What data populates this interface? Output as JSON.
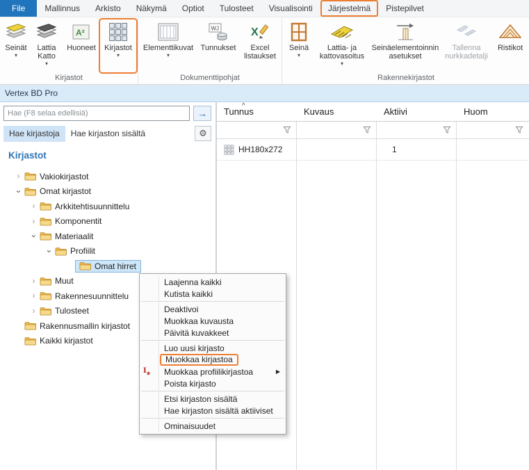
{
  "icons": {
    "chevron_down": "▾",
    "submenu_arrow": "▶",
    "gear": "⚙",
    "search_go_arrow": "→",
    "sort_ascending": "^",
    "huoneet_icon_text": "A²",
    "tunnukset_icon_text": "WJ",
    "excel_icon_text": "X"
  },
  "colors": {
    "file_tab_blue": "#2175bc",
    "annotation_orange": "#ed7d31",
    "selection_blue": "#cde6f8",
    "tree_heading_blue": "#2e74b5"
  },
  "ribbon": {
    "tabs": {
      "file": "File",
      "mallinnus": "Mallinnus",
      "arkisto": "Arkisto",
      "nakyma": "Näkymä",
      "optiot": "Optiot",
      "tulosteet": "Tulosteet",
      "visualisointi": "Visualisointi",
      "jarjestelma": "Järjestelmä",
      "pistepilvet": "Pistepilvet"
    },
    "buttons": {
      "seinat": "Seinät",
      "lattia_katto": "Lattia Katto",
      "huoneet": "Huoneet",
      "kirjastot": "Kirjastot",
      "elementtikuvat": "Elementtikuvat",
      "tunnukset": "Tunnukset",
      "excel_listaukset": "Excel listaukset",
      "seina": "Seinä",
      "lattia_ja_kattovasoitus": "Lattia- ja kattovasoitus",
      "seinaelementoinnin_asetukset": "Seinäelementoinnin asetukset",
      "tallenna_nurkkadetalji": "Tallenna nurkkadetalji",
      "ristikot": "Ristikot"
    },
    "group_labels": {
      "kirjastot": "Kirjastot",
      "dokumenttipohjat": "Dokumenttipohjat",
      "rakennekirjastot": "Rakennekirjastot"
    }
  },
  "panel": {
    "title": "Vertex BD Pro",
    "search_placeholder": "Hae (F8 selaa edellisiä)",
    "tab_hae_kirjastoja": "Hae kirjastoja",
    "tab_hae_sisalta": "Hae kirjaston sisältä"
  },
  "tree": {
    "heading": "Kirjastot",
    "items": [
      "Vakiokirjastot",
      "Omat kirjastot",
      "Arkkitehtisuunnittelu",
      "Komponentit",
      "Materiaalit",
      "Profiilit",
      "Omat hirret",
      "Muut",
      "Rakennesuunnittelu",
      "Tulosteet",
      "Rakennusmallin kirjastot",
      "Kaikki kirjastot"
    ]
  },
  "context_menu": {
    "items": [
      "Laajenna kaikki",
      "Kutista kaikki",
      "Deaktivoi",
      "Muokkaa kuvausta",
      "Päivitä kuvakkeet",
      "Luo uusi kirjasto",
      "Muokkaa kirjastoa",
      "Muokkaa profiilikirjastoa",
      "Poista kirjasto",
      "Etsi kirjaston sisältä",
      "Hae kirjaston sisältä aktiiviset",
      "Ominaisuudet"
    ]
  },
  "table": {
    "columns": {
      "tunnus": "Tunnus",
      "kuvaus": "Kuvaus",
      "aktiivi": "Aktiivi",
      "huom": "Huom"
    },
    "rows": [
      {
        "tunnus": "HH180x272",
        "kuvaus": "",
        "aktiivi": "1",
        "huom": ""
      }
    ]
  }
}
